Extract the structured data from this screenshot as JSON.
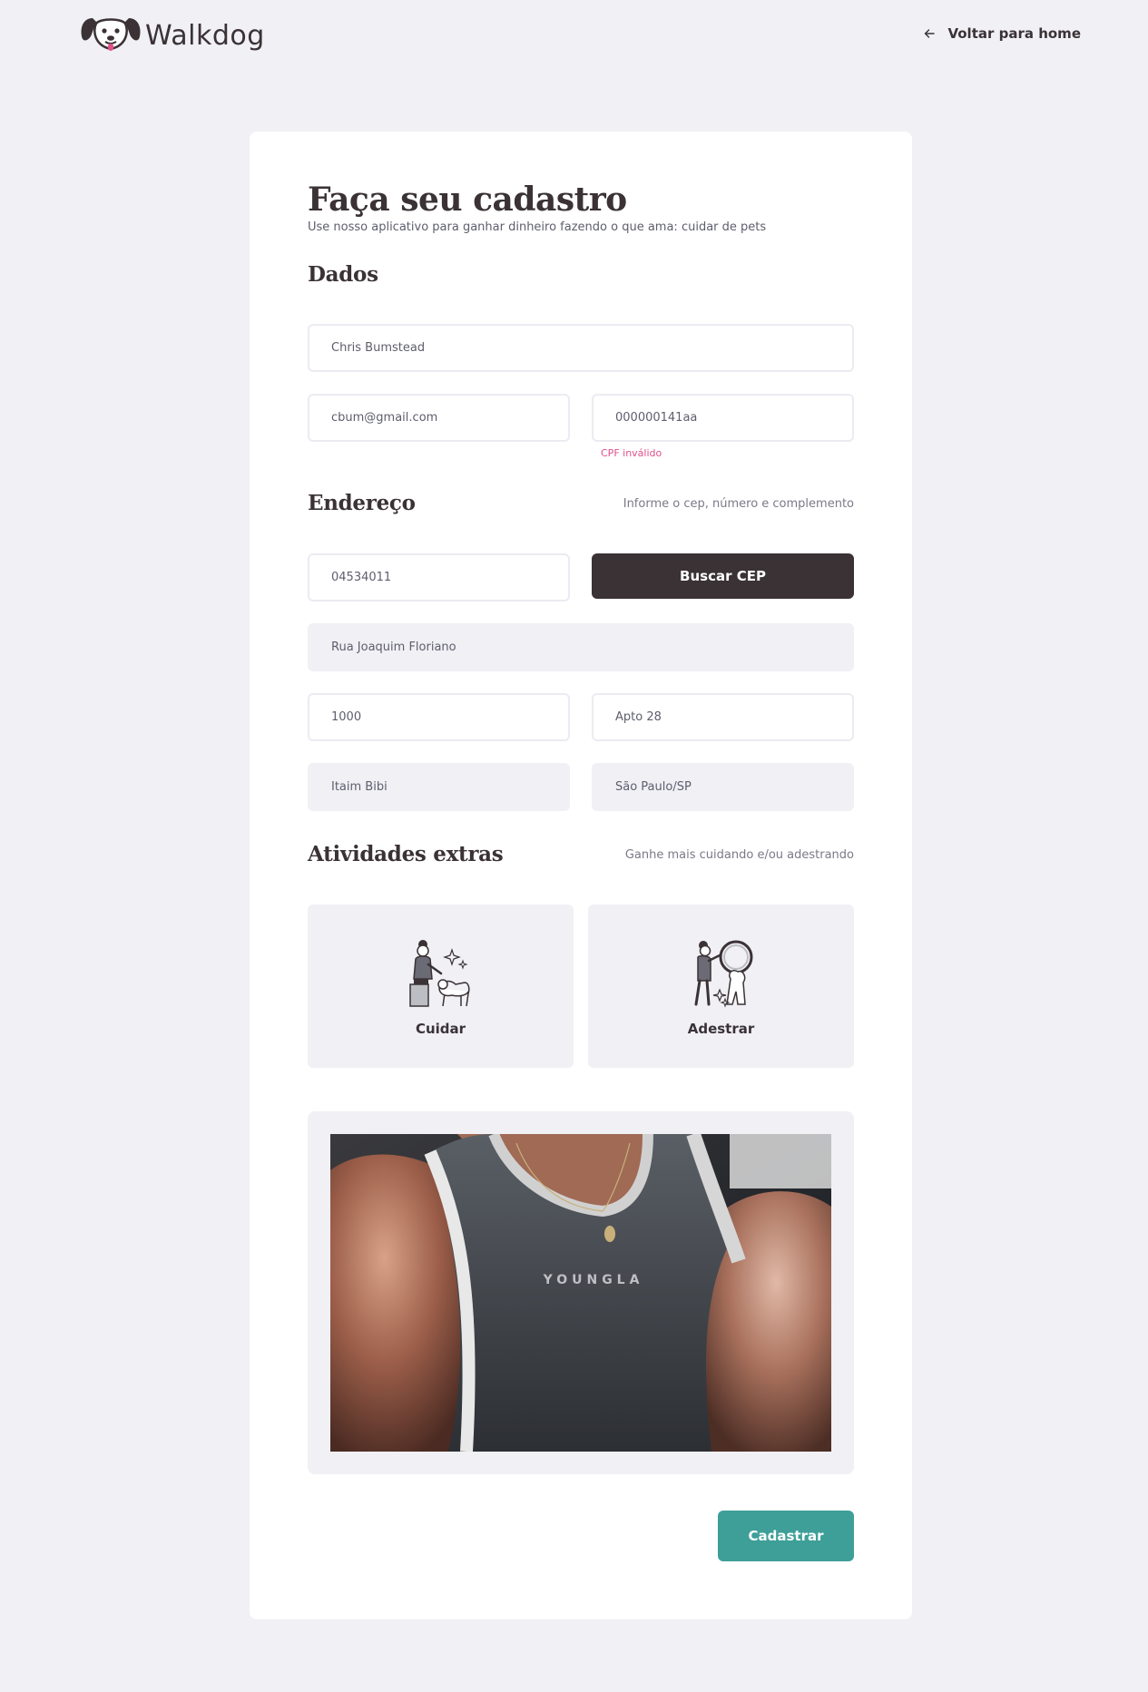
{
  "header": {
    "brand": "Walkdog",
    "back_label": "Voltar para home"
  },
  "form": {
    "title": "Faça seu cadastro",
    "subtitle": "Use nosso aplicativo para ganhar dinheiro fazendo o que ama: cuidar de pets",
    "dados": {
      "title": "Dados",
      "name": "Chris Bumstead",
      "email": "cbum@gmail.com",
      "cpf": "000000141aa",
      "cpf_error": "CPF inválido"
    },
    "endereco": {
      "title": "Endereço",
      "hint": "Informe o cep, número e complemento",
      "cep": "04534011",
      "buscar_label": "Buscar CEP",
      "street": "Rua Joaquim Floriano",
      "number": "1000",
      "complement": "Apto 28",
      "district": "Itaim Bibi",
      "city": "São Paulo/SP"
    },
    "atividades": {
      "title": "Atividades extras",
      "hint": "Ganhe mais cuidando e/ou adestrando",
      "options": [
        {
          "label": "Cuidar",
          "icon": "pet-care-icon"
        },
        {
          "label": "Adestrar",
          "icon": "pet-training-icon"
        }
      ]
    },
    "photo": {
      "shirt_text": "YOUNGLA"
    },
    "submit_label": "Cadastrar"
  },
  "colors": {
    "background": "#f0f0f5",
    "dark": "#3a3235",
    "accent": "#3e9f99",
    "error": "#e0518b"
  }
}
